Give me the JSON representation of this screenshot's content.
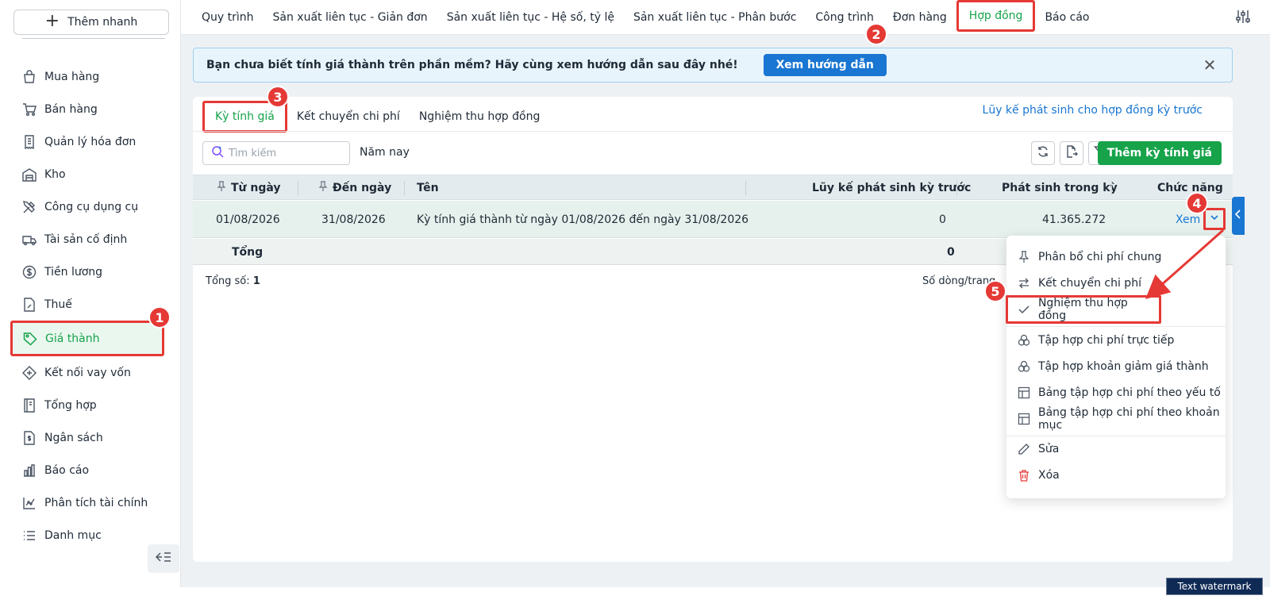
{
  "sidebar": {
    "quick_add": "Thêm nhanh",
    "items": [
      {
        "label": "Mua hàng",
        "icon": "shopping-bag-icon"
      },
      {
        "label": "Bán hàng",
        "icon": "cart-icon"
      },
      {
        "label": "Quản lý hóa đơn",
        "icon": "receipt-icon"
      },
      {
        "label": "Kho",
        "icon": "warehouse-icon"
      },
      {
        "label": "Công cụ dụng cụ",
        "icon": "tools-icon"
      },
      {
        "label": "Tài sản cố định",
        "icon": "truck-icon"
      },
      {
        "label": "Tiền lương",
        "icon": "dollar-circle-icon"
      },
      {
        "label": "Thuế",
        "icon": "tax-doc-icon"
      },
      {
        "label": "Giá thành",
        "icon": "tag-icon"
      },
      {
        "label": "Kết nối vay vốn",
        "icon": "loan-icon"
      },
      {
        "label": "Tổng hợp",
        "icon": "ledger-icon"
      },
      {
        "label": "Ngân sách",
        "icon": "budget-doc-icon"
      },
      {
        "label": "Báo cáo",
        "icon": "bar-chart-icon"
      },
      {
        "label": "Phân tích tài chính",
        "icon": "analytics-icon"
      },
      {
        "label": "Danh mục",
        "icon": "list-icon"
      }
    ]
  },
  "topnav": {
    "tabs": [
      "Quy trình",
      "Sản xuất liên tục - Giản đơn",
      "Sản xuất liên tục - Hệ số, tỷ lệ",
      "Sản xuất liên tục - Phân bước",
      "Công trình",
      "Đơn hàng",
      "Hợp đồng",
      "Báo cáo"
    ]
  },
  "banner": {
    "text": "Bạn chưa biết tính giá thành trên phần mềm? Hãy cùng xem hướng dẫn sau đây nhé!",
    "button": "Xem hướng dẫn",
    "close": "✕"
  },
  "subtabs": [
    "Kỳ tính giá",
    "Kết chuyển chi phí",
    "Nghiệm thu hợp đồng"
  ],
  "top_link": "Lũy kế phát sinh cho hợp đồng kỳ trước",
  "toolbar": {
    "search_placeholder": "Tìm kiếm",
    "year_filter": "Năm nay",
    "add_button": "Thêm kỳ tính giá"
  },
  "table": {
    "headers": [
      "Từ ngày",
      "Đến ngày",
      "Tên",
      "Lũy kế phát sinh kỳ trước",
      "Phát sinh trong kỳ",
      "Chức năng"
    ],
    "rows": [
      {
        "from": "01/08/2026",
        "to": "31/08/2026",
        "name": "Kỳ tính giá thành từ ngày 01/08/2026 đến ngày 31/08/2026",
        "prior": "0",
        "current": "41.365.272",
        "action": "Xem"
      }
    ],
    "total_label": "Tổng",
    "total_prior": "0"
  },
  "footer": {
    "count_label": "Tổng số:",
    "count_value": "1",
    "rows_per_page": "Số dòng/trang"
  },
  "menu": {
    "items": [
      {
        "label": "Phân bổ chi phí chung",
        "icon": "pin-icon"
      },
      {
        "label": "Kết chuyển chi phí",
        "icon": "transfer-icon"
      },
      {
        "label": "Nghiệm thu hợp đồng",
        "icon": "check-icon"
      },
      {
        "label": "Tập hợp chi phí trực tiếp",
        "icon": "circles-icon"
      },
      {
        "label": "Tập hợp khoản giảm giá thành",
        "icon": "circles-icon"
      },
      {
        "label": "Bảng tập hợp chi phí theo yếu tố",
        "icon": "table-icon"
      },
      {
        "label": "Bảng tập hợp chi phí theo khoản mục",
        "icon": "table-icon"
      },
      {
        "label": "Sửa",
        "icon": "pencil-icon"
      },
      {
        "label": "Xóa",
        "icon": "trash-icon"
      }
    ]
  },
  "badges": [
    "1",
    "2",
    "3",
    "4",
    "5"
  ],
  "watermark": "Text watermark",
  "colors": {
    "accent_green": "#16a34a",
    "link_blue": "#1976d2",
    "annotation_red": "#e53935"
  }
}
